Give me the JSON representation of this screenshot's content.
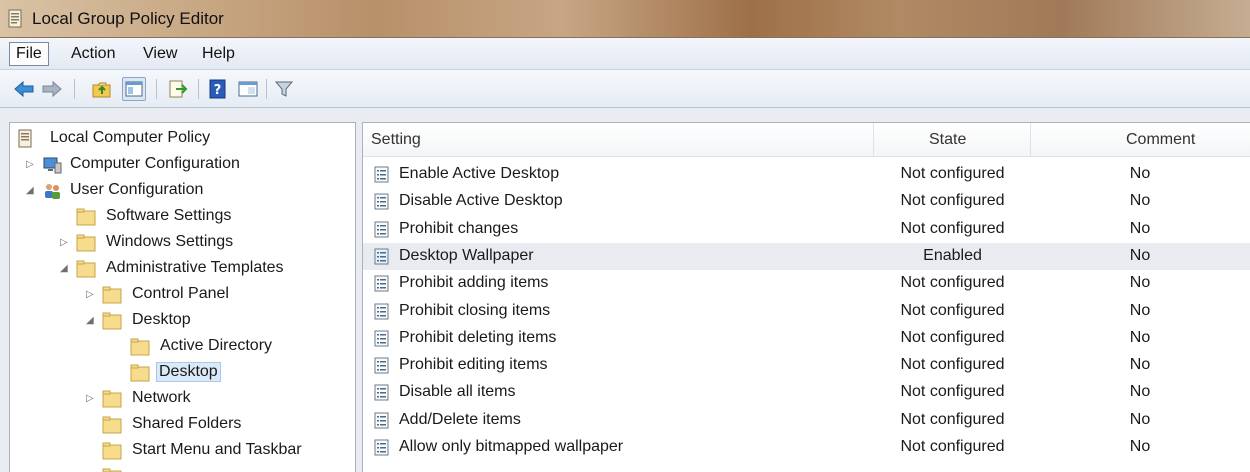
{
  "window": {
    "title": "Local Group Policy Editor"
  },
  "menu": [
    {
      "label": "File",
      "active": true
    },
    {
      "label": "Action"
    },
    {
      "label": "View"
    },
    {
      "label": "Help"
    }
  ],
  "toolbar": [
    {
      "icon": "back-arrow-icon"
    },
    {
      "icon": "forward-arrow-icon"
    },
    {
      "icon": "up-folder-icon"
    },
    {
      "icon": "show-hide-console-tree-icon",
      "pressed": true
    },
    {
      "icon": "export-list-icon"
    },
    {
      "icon": "help-icon"
    },
    {
      "icon": "extended-view-icon"
    },
    {
      "icon": "filter-icon"
    }
  ],
  "tree": [
    {
      "label": "Local Computer Policy",
      "icon": "policy-doc-icon",
      "expander": ""
    },
    {
      "label": "Computer Configuration",
      "icon": "computer-icon",
      "expander": "collapsed"
    },
    {
      "label": "User Configuration",
      "icon": "users-icon",
      "expander": "expanded"
    },
    {
      "label": "Software Settings",
      "icon": "folder-icon",
      "expander": ""
    },
    {
      "label": "Windows Settings",
      "icon": "folder-icon",
      "expander": "collapsed"
    },
    {
      "label": "Administrative Templates",
      "icon": "folder-icon",
      "expander": "expanded"
    },
    {
      "label": "Control Panel",
      "icon": "folder-icon",
      "expander": "collapsed"
    },
    {
      "label": "Desktop",
      "icon": "folder-icon",
      "expander": "expanded"
    },
    {
      "label": "Active Directory",
      "icon": "folder-icon",
      "expander": ""
    },
    {
      "label": "Desktop",
      "icon": "folder-icon",
      "expander": "",
      "selected": true
    },
    {
      "label": "Network",
      "icon": "folder-icon",
      "expander": "collapsed"
    },
    {
      "label": "Shared Folders",
      "icon": "folder-icon",
      "expander": ""
    },
    {
      "label": "Start Menu and Taskbar",
      "icon": "folder-icon",
      "expander": ""
    }
  ],
  "list": {
    "columns": [
      "Setting",
      "State",
      "Comment"
    ],
    "rows": [
      {
        "setting": "Enable Active Desktop",
        "state": "Not configured",
        "comment": "No"
      },
      {
        "setting": "Disable Active Desktop",
        "state": "Not configured",
        "comment": "No"
      },
      {
        "setting": "Prohibit changes",
        "state": "Not configured",
        "comment": "No"
      },
      {
        "setting": "Desktop Wallpaper",
        "state": "Enabled",
        "comment": "No",
        "highlighted": true
      },
      {
        "setting": "Prohibit adding items",
        "state": "Not configured",
        "comment": "No"
      },
      {
        "setting": "Prohibit closing items",
        "state": "Not configured",
        "comment": "No"
      },
      {
        "setting": "Prohibit deleting items",
        "state": "Not configured",
        "comment": "No"
      },
      {
        "setting": "Prohibit editing items",
        "state": "Not configured",
        "comment": "No"
      },
      {
        "setting": "Disable all items",
        "state": "Not configured",
        "comment": "No"
      },
      {
        "setting": "Add/Delete items",
        "state": "Not configured",
        "comment": "No"
      },
      {
        "setting": "Allow only bitmapped wallpaper",
        "state": "Not configured",
        "comment": "No"
      }
    ]
  }
}
